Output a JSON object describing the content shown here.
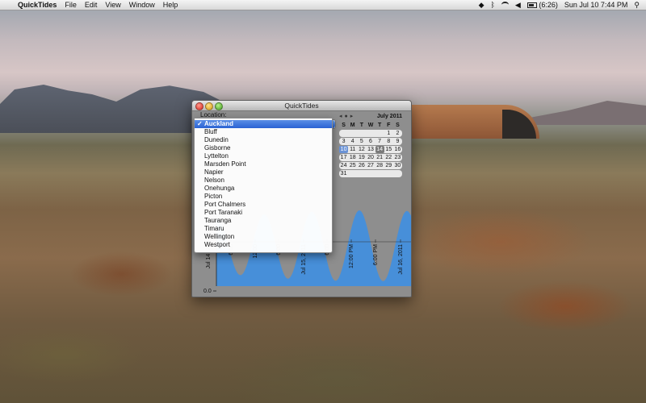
{
  "menubar": {
    "app_name": "QuickTides",
    "menus": [
      "File",
      "Edit",
      "View",
      "Window",
      "Help"
    ],
    "battery": "(6:26)",
    "clock": "Sun Jul 10  7:44 PM"
  },
  "window": {
    "title": "QuickTides",
    "location_label": "Location:"
  },
  "dropdown": {
    "selected": "Auckland",
    "items": [
      "Auckland",
      "Bluff",
      "Dunedin",
      "Gisborne",
      "Lyttelton",
      "Marsden Point",
      "Napier",
      "Nelson",
      "Onehunga",
      "Picton",
      "Port Chalmers",
      "Port Taranaki",
      "Tauranga",
      "Timaru",
      "Wellington",
      "Westport"
    ]
  },
  "calendar": {
    "month": "July 2011",
    "nav": [
      "◂",
      "●",
      "▸"
    ],
    "dow": [
      "S",
      "M",
      "T",
      "W",
      "T",
      "F",
      "S"
    ],
    "weeks": [
      [
        "",
        "",
        "",
        "",
        "",
        "1",
        "2"
      ],
      [
        "3",
        "4",
        "5",
        "6",
        "7",
        "8",
        "9"
      ],
      [
        "10",
        "11",
        "12",
        "13",
        "14",
        "15",
        "16"
      ],
      [
        "17",
        "18",
        "19",
        "20",
        "21",
        "22",
        "23"
      ],
      [
        "24",
        "25",
        "26",
        "27",
        "28",
        "29",
        "30"
      ],
      [
        "31",
        "",
        "",
        "",
        "",
        "",
        ""
      ]
    ],
    "today": "10",
    "selected": "14"
  },
  "chart_data": {
    "type": "area",
    "y_tick_label": "0.0",
    "x_tick_labels": [
      "Jul 14, 20",
      "6:00",
      "12:00",
      "6:00",
      "Jul 15, 2011",
      "6:00",
      "12:00 PM",
      "6:00 PM",
      "Jul 16, 2011"
    ],
    "series_color": "#3b8fe6"
  }
}
